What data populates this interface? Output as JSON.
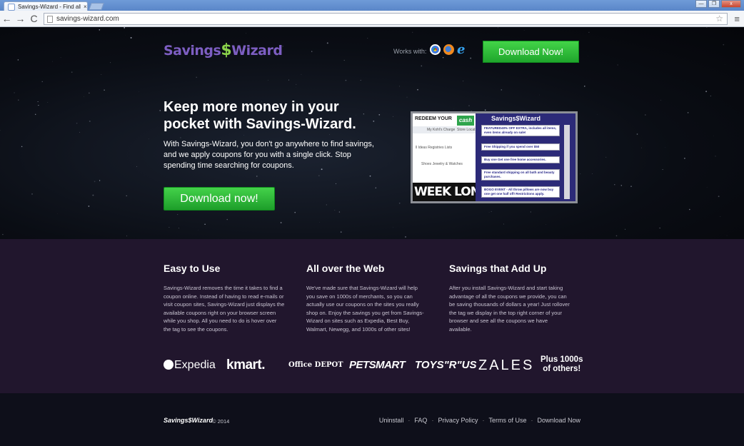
{
  "browser": {
    "tab_title": "Savings-Wizard - Find all t",
    "tab_close": "×",
    "url": "savings-wizard.com",
    "back": "←",
    "forward": "→",
    "reload": "C",
    "star": "☆",
    "menu": "≡",
    "win_min": "—",
    "win_max": "❐",
    "win_close": "x"
  },
  "hero": {
    "logo_left": "Savings",
    "logo_mark": "$",
    "logo_right": "Wizard",
    "works_with": "Works with:",
    "top_download": "Download Now!",
    "headline": "Keep more money in your pocket with Savings-Wizard.",
    "subtext": "With Savings-Wizard, you don't go anywhere to find savings, and we apply coupons for you with a single click. Stop spending time searching for coupons.",
    "download_button": "Download now!"
  },
  "preview": {
    "redeem": "REDEEM YOUR",
    "cash": "cash",
    "kohls": "My Kohl's Charge",
    "store": "Store Locat",
    "row2": "ll Ideas   Registries   Lists",
    "row3": "Shoes      Jewelry & Watches",
    "week": "WEEK LONG!",
    "panel_logo": "Savings$Wizard",
    "coupons": [
      "FEATURED40% OFF EXTRA, includes all items, even items already on sale!",
      "Free Shipping if you spend over $50",
      "Buy one Get one free home accessories.",
      "Free standard shipping on all bath and beauty purchases.",
      "BOGO EVENT - All throw pillows are now buy one get one half off! Restrictions apply."
    ]
  },
  "features": [
    {
      "title": "Easy to Use",
      "text": "Savings-Wizard removes the time it takes to find a coupon online. Instead of having to read e-mails or visit coupon sites, Savings-Wizard just displays the available coupons right on your browser screen while you shop. All you need to do is hover over the tag to see the coupons."
    },
    {
      "title": "All over the Web",
      "text": "We've made sure that Savings-Wizard will help you save on 1000s of merchants, so you can actually use our coupons on the sites you really shop on. Enjoy the savings you get from Savings-Wizard on sites such as Expedia, Best Buy, Walmart, Newegg, and 1000s of other sites!"
    },
    {
      "title": "Savings that Add Up",
      "text": "After you install Savings-Wizard and start taking advantage of all the coupons we provide, you can be saving thousands of dollars a year! Just rollover the tag we display in the top right corner of your browser and see all the coupons we have available."
    }
  ],
  "brands": {
    "expedia": "Expedia",
    "kmart": "kmart.",
    "office": "Office DEPOT",
    "petsmart": "PETSMART",
    "toys": "TOYS\"R\"US",
    "zales": "ZALES",
    "plus_line1": "Plus 1000s",
    "plus_line2": "of others!"
  },
  "footer": {
    "logo": "Savings$Wizard",
    "copyright": "© 2014",
    "links": [
      "Uninstall",
      "FAQ",
      "Privacy Policy",
      "Terms of Use",
      "Download Now"
    ]
  }
}
